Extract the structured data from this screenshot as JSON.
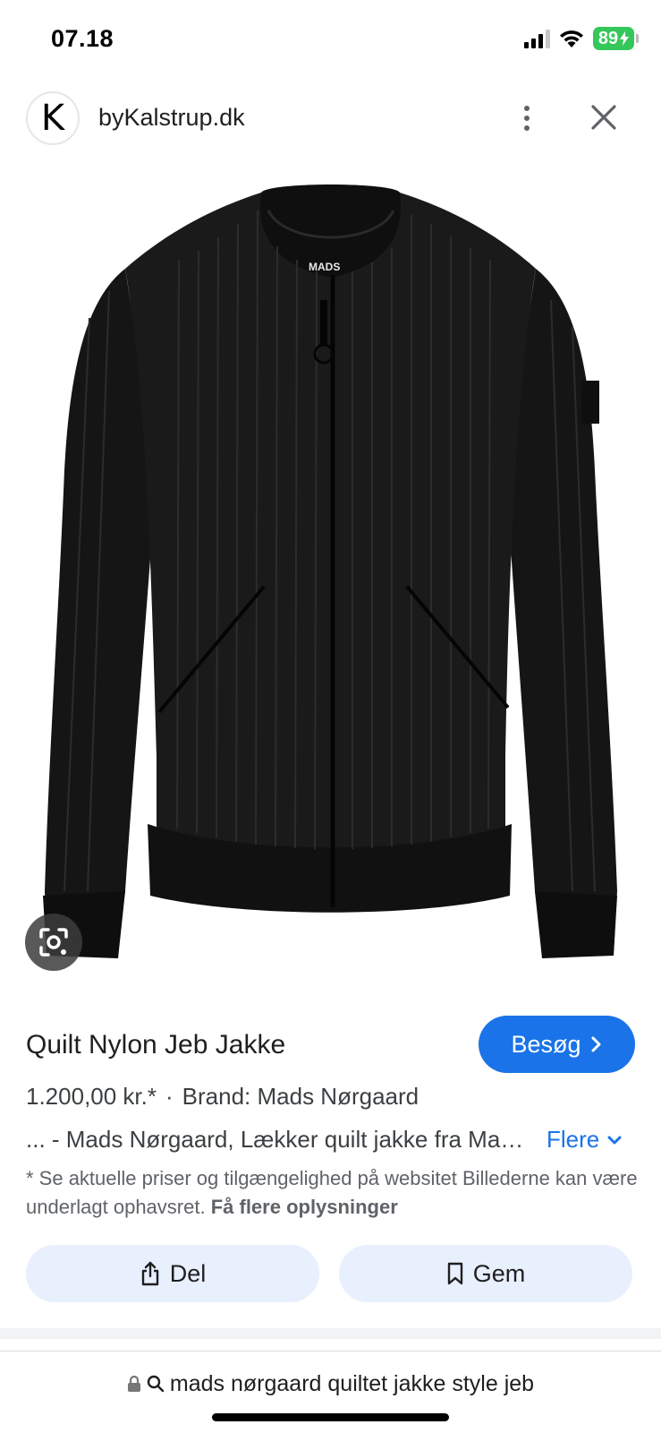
{
  "status_bar": {
    "time": "07.18",
    "battery": "89"
  },
  "header": {
    "logo_letter": "K",
    "site_name": "byKalstrup.dk",
    "more_icon": "more-vert-icon",
    "close_icon": "close-icon"
  },
  "product": {
    "image_icon": "jacket-image",
    "brand_tag": "MADS",
    "title": "Quilt Nylon Jeb Jakke",
    "visit_label": "Besøg",
    "price": "1.200,00 kr.*",
    "separator": "·",
    "brand": "Brand: Mads Nørgaard",
    "description": "... - Mads Nørgaard, Lækker quilt jakke fra Mads Nørgaard",
    "more_label": "Flere",
    "disclaimer": "* Se aktuelle priser og tilgængelighed på websitet Billederne kan være underlagt ophavsret.",
    "disclaimer_link": "Få flere oplysninger"
  },
  "actions": {
    "share_label": "Del",
    "save_label": "Gem"
  },
  "address_bar": {
    "query": "mads nørgaard quiltet jakke style jeb"
  },
  "colors": {
    "accent": "#1a73e8",
    "button_bg": "#e8effd",
    "battery": "#34c759"
  }
}
